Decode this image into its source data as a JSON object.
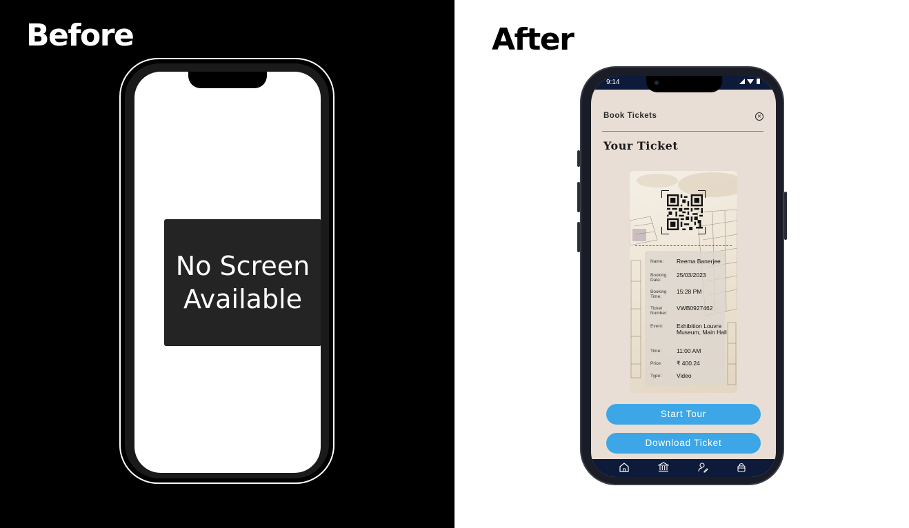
{
  "headings": {
    "before": "Before",
    "after": "After"
  },
  "before_phone": {
    "placeholder_line1": "No Screen",
    "placeholder_line2": "Available"
  },
  "after_phone": {
    "status_time": "9:14",
    "header": {
      "title": "Book Tickets",
      "close_icon": "close-circle-icon"
    },
    "page_title": "Your Ticket",
    "ticket": {
      "qr_icon": "qr-code-icon",
      "fields": [
        {
          "label": "Name:",
          "value": "Reema Banerjee"
        },
        {
          "label": "Booking Date:",
          "value": "25/03/2023"
        },
        {
          "label": "Booking Time:",
          "value": "15:28 PM"
        },
        {
          "label": "Ticket Number:",
          "value": "VWB0927462"
        },
        {
          "label": "Event:",
          "value": "Exhibition Louvre Museum, Main Hall"
        },
        {
          "label": "Time:",
          "value": "11:00 AM"
        },
        {
          "label": "Price:",
          "value": "₹ 400.24"
        },
        {
          "label": "Type:",
          "value": "Video"
        }
      ]
    },
    "buttons": {
      "start_tour": "Start Tour",
      "download_ticket": "Download Ticket"
    },
    "tabbar": [
      "home-icon",
      "museum-icon",
      "user-edit-icon",
      "bag-icon"
    ],
    "colors": {
      "accent": "#3da6e6",
      "bar": "#0d1a3a",
      "background": "#e8ded5"
    }
  }
}
